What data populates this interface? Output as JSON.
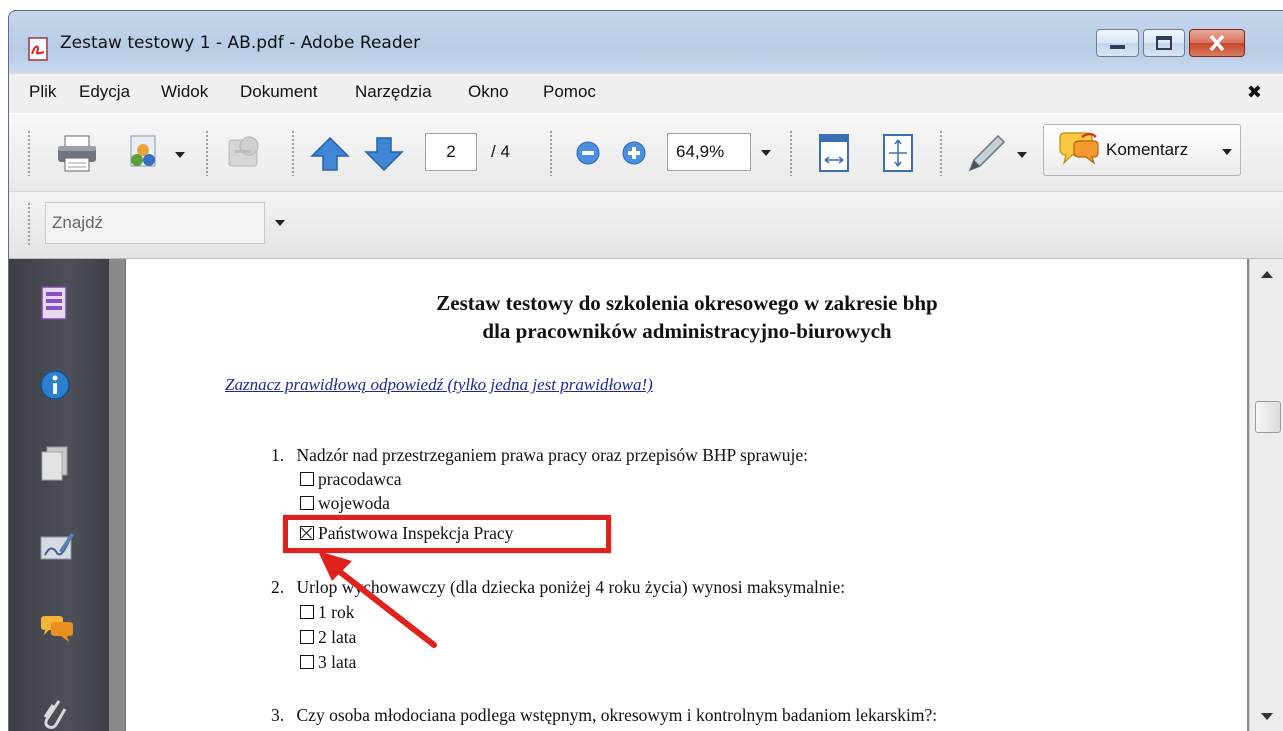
{
  "window": {
    "title": "Zestaw testowy 1 - AB.pdf - Adobe Reader"
  },
  "menu": {
    "items": [
      "Plik",
      "Edycja",
      "Widok",
      "Dokument",
      "Narzędzia",
      "Okno",
      "Pomoc"
    ],
    "close_glyph": "✖"
  },
  "toolbar": {
    "page_current": "2",
    "page_total": "/ 4",
    "zoom": "64,9%",
    "comment_label": "Komentarz",
    "icons": [
      "printer-icon",
      "share-icon",
      "collaborate-icon",
      "previous-page-icon",
      "next-page-icon",
      "zoom-out-icon",
      "zoom-in-icon",
      "fit-width-icon",
      "fit-page-icon",
      "pen-icon",
      "comment-icon"
    ]
  },
  "find": {
    "placeholder": "Znajdź"
  },
  "nav_pane": {
    "icons": [
      "pages-icon",
      "info-icon",
      "page-icon",
      "signature-icon",
      "comments-icon",
      "attachment-icon"
    ]
  },
  "document": {
    "title_line1": "Zestaw testowy do szkolenia okresowego w zakresie bhp",
    "title_line2": "dla pracowników administracyjno-biurowych",
    "instruction": "Zaznacz prawidłową odpowiedź (tylko jedna jest prawidłowa!)",
    "questions": [
      {
        "number": "1.",
        "text": "Nadzór nad przestrzeganiem prawa pracy oraz przepisów BHP sprawuje:",
        "options": [
          {
            "label": "pracodawca",
            "checked": false
          },
          {
            "label": "wojewoda",
            "checked": false
          },
          {
            "label": "Państwowa Inspekcja Pracy",
            "checked": true
          }
        ]
      },
      {
        "number": "2.",
        "text": "Urlop wychowawczy (dla dziecka poniżej 4 roku życia) wynosi maksymalnie:",
        "options": [
          {
            "label": "1 rok",
            "checked": false
          },
          {
            "label": "2 lata",
            "checked": false
          },
          {
            "label": "3 lata",
            "checked": false
          }
        ]
      },
      {
        "number": "3.",
        "text": "Czy osoba młodociana podlega wstępnym, okresowym i kontrolnym badaniom lekarskim?:",
        "options": []
      }
    ]
  },
  "annotation": {
    "highlight_color": "#e1211c",
    "arrow_color": "#e1211c"
  }
}
